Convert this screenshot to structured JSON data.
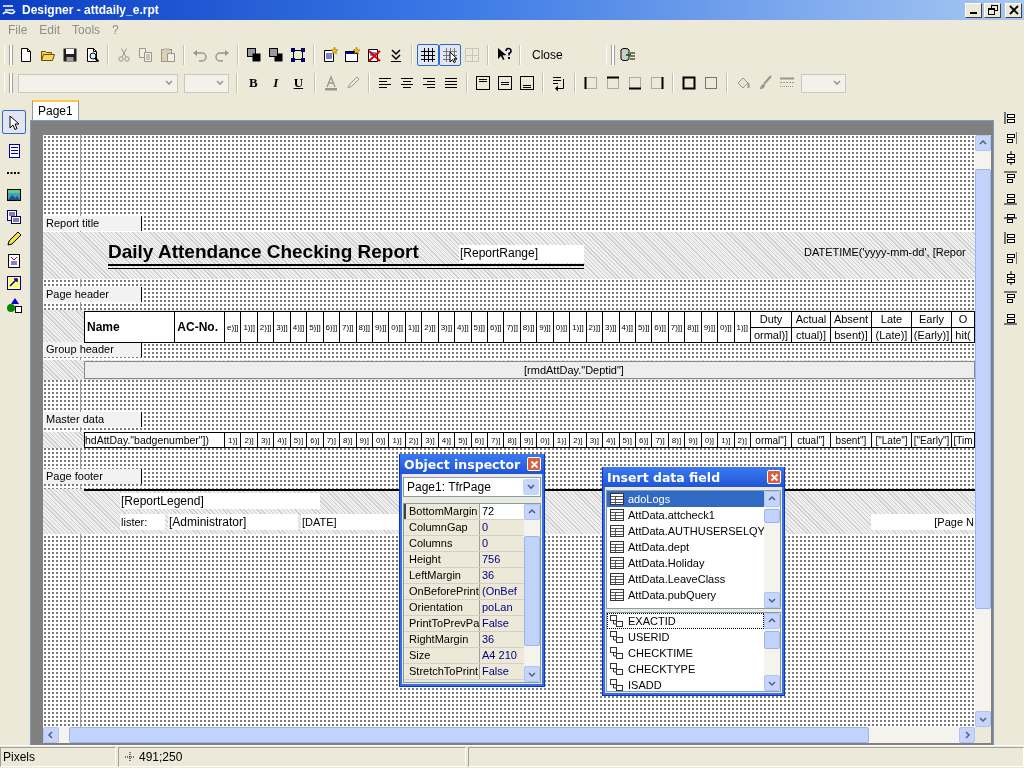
{
  "window": {
    "title": "Designer - attdaily_e.rpt"
  },
  "menu": [
    {
      "label": "File",
      "disabled": true
    },
    {
      "label": "Edit",
      "disabled": true
    },
    {
      "label": "Tools",
      "disabled": true
    },
    {
      "label": "?",
      "disabled": true
    }
  ],
  "toolbars": [
    {
      "items": [
        {
          "kind": "icon",
          "pressed": false,
          "disabled": false
        },
        {
          "kind": "icon",
          "pressed": false,
          "disabled": false
        },
        {
          "kind": "icon",
          "pressed": false,
          "disabled": false
        },
        {
          "kind": "icon",
          "pressed": false,
          "disabled": false
        },
        {
          "kind": "separator"
        },
        {
          "kind": "icon",
          "pressed": false,
          "disabled": true
        },
        {
          "kind": "icon",
          "pressed": false,
          "disabled": true
        },
        {
          "kind": "icon",
          "pressed": false,
          "disabled": true
        },
        {
          "kind": "separator"
        },
        {
          "kind": "icon",
          "pressed": false,
          "disabled": true
        },
        {
          "kind": "icon",
          "pressed": false,
          "disabled": true
        },
        {
          "kind": "separator"
        },
        {
          "kind": "icon",
          "pressed": false,
          "disabled": false
        },
        {
          "kind": "icon",
          "pressed": false,
          "disabled": false
        },
        {
          "kind": "icon",
          "pressed": false,
          "disabled": false
        },
        {
          "kind": "separator"
        },
        {
          "kind": "icon",
          "pressed": false,
          "disabled": false
        },
        {
          "kind": "icon",
          "pressed": false,
          "disabled": false
        },
        {
          "kind": "icon",
          "pressed": false,
          "disabled": false
        },
        {
          "kind": "icon",
          "pressed": false,
          "disabled": false
        },
        {
          "kind": "separator"
        },
        {
          "kind": "icon",
          "pressed": true,
          "disabled": false
        },
        {
          "kind": "icon",
          "pressed": true,
          "disabled": false
        },
        {
          "kind": "icon",
          "pressed": false,
          "disabled": true
        },
        {
          "kind": "separator"
        },
        {
          "kind": "icon",
          "pressed": false,
          "disabled": false
        },
        {
          "kind": "separator"
        },
        {
          "kind": "text",
          "label": "Close",
          "disabled": false
        }
      ]
    },
    {
      "items": [
        {
          "kind": "icon",
          "pressed": false,
          "disabled": false
        }
      ]
    },
    {
      "items": [
        {
          "kind": "combo",
          "disabled": true
        },
        {
          "kind": "combo",
          "disabled": true
        },
        {
          "kind": "separator"
        },
        {
          "kind": "text",
          "label": "B",
          "disabled": false
        },
        {
          "kind": "text",
          "label": "I",
          "disabled": false
        },
        {
          "kind": "text",
          "label": "U",
          "disabled": false
        },
        {
          "kind": "separator"
        },
        {
          "kind": "icon",
          "pressed": false,
          "disabled": true
        },
        {
          "kind": "icon",
          "pressed": false,
          "disabled": true
        },
        {
          "kind": "separator"
        },
        {
          "kind": "icon",
          "pressed": false,
          "disabled": false
        },
        {
          "kind": "icon",
          "pressed": false,
          "disabled": false
        },
        {
          "kind": "icon",
          "pressed": false,
          "disabled": false
        },
        {
          "kind": "icon",
          "pressed": false,
          "disabled": false
        },
        {
          "kind": "separator"
        },
        {
          "kind": "icon",
          "pressed": false,
          "disabled": false
        },
        {
          "kind": "icon",
          "pressed": false,
          "disabled": false
        },
        {
          "kind": "icon",
          "pressed": false,
          "disabled": false
        },
        {
          "kind": "separator"
        },
        {
          "kind": "icon",
          "pressed": false,
          "disabled": false
        },
        {
          "kind": "separator"
        },
        {
          "kind": "icon",
          "pressed": false,
          "disabled": false
        },
        {
          "kind": "icon",
          "pressed": false,
          "disabled": false
        },
        {
          "kind": "icon",
          "pressed": false,
          "disabled": false
        },
        {
          "kind": "icon",
          "pressed": false,
          "disabled": false
        },
        {
          "kind": "separator"
        },
        {
          "kind": "icon",
          "pressed": false,
          "disabled": false
        },
        {
          "kind": "icon",
          "pressed": false,
          "disabled": false
        },
        {
          "kind": "separator"
        },
        {
          "kind": "icon",
          "pressed": false,
          "disabled": true
        },
        {
          "kind": "icon",
          "pressed": false,
          "disabled": true
        },
        {
          "kind": "icon",
          "pressed": false,
          "disabled": true
        },
        {
          "kind": "combo",
          "disabled": true
        }
      ]
    }
  ],
  "tool_palette": [
    {
      "selected": true
    },
    {
      "selected": false
    },
    {
      "selected": false
    },
    {
      "selected": false
    },
    {
      "selected": false
    },
    {
      "selected": false
    },
    {
      "selected": false
    },
    {
      "selected": false
    },
    {
      "selected": false
    }
  ],
  "tabs": [
    {
      "label": "Page1",
      "selected": true
    }
  ],
  "report": {
    "bands": [
      {
        "label": "Report title"
      },
      {
        "label": "Page header"
      },
      {
        "label": "Group header"
      },
      {
        "label": "Master data"
      },
      {
        "label": "Page footer"
      }
    ],
    "report_title": {
      "title": "Daily Attendance Checking Report",
      "range": "[ReportRange]",
      "date_expression": "DATETIME('yyyy-mm-dd', [Repor"
    },
    "page_header": {
      "columns": [
        "Name",
        "AC-No."
      ],
      "day_cells": [
        "e)]]",
        "1)]]",
        "2)]]",
        "3)]]",
        "4)]]",
        "5)]]",
        "6)]]",
        "7)]]",
        "8)]]",
        "9)]]",
        "0)]]",
        "1)]]",
        "2)]]",
        "3)]]",
        "4)]]",
        "5)]]",
        "6)]]",
        "7)]]",
        "8)]]",
        "9)]]",
        "0)]]",
        "1)]]",
        "2)]]",
        "3)]]",
        "4)]]",
        "5)]]",
        "6)]]",
        "7)]]",
        "8)]]",
        "9)]]",
        "0)]]",
        "1)]]"
      ],
      "summary_columns": [
        {
          "heading": "Duty",
          "field": "ormal)]"
        },
        {
          "heading": "Actual",
          "field": "ctual)]"
        },
        {
          "heading": "Absent",
          "field": "bsent)]"
        },
        {
          "heading": "Late",
          "field": "(Late)]"
        },
        {
          "heading": "Early",
          "field": "(Early)]"
        },
        {
          "heading": "O",
          "field": "hit("
        }
      ]
    },
    "group_header": {
      "field": "[rmdAttDay.\"Deptid\"]"
    },
    "master_data": {
      "badge_field": "hdAttDay.\"badgenumber\"])",
      "day_cells": [
        "1)]",
        "2)]",
        "3)]",
        "4)]",
        "5)]",
        "6)]",
        "7)]",
        "8)]",
        "9)]",
        "0)]",
        "1)]",
        "2)]",
        "3)]",
        "4)]",
        "5)]",
        "6)]",
        "7)]",
        "8)]",
        "9)]",
        "0)]",
        "1)]",
        "2)]",
        "3)]",
        "4)]",
        "5)]",
        "6)]",
        "7)]",
        "8)]",
        "9)]",
        "0)]",
        "1)]",
        "2)]"
      ],
      "summary_cells": [
        "ormal\"]",
        "ctual\"]",
        "bsent\"]",
        "[\"Late\"]",
        "[\"Early\"]",
        "[Tim"
      ]
    },
    "page_footer": {
      "legend": "[ReportLegend]",
      "lister_label": "lister:",
      "lister": "[Administrator]",
      "date": "[DATE]",
      "page_number": "[Page N"
    }
  },
  "object_inspector": {
    "title": "Object inspector",
    "object": "Page1: TfrPage",
    "properties": [
      {
        "name": "BottomMargin",
        "value": "72",
        "selected": true
      },
      {
        "name": "ColumnGap",
        "value": "0",
        "selected": false
      },
      {
        "name": "Columns",
        "value": "0",
        "selected": false
      },
      {
        "name": "Height",
        "value": "756",
        "selected": false
      },
      {
        "name": "LeftMargin",
        "value": "36",
        "selected": false
      },
      {
        "name": "OnBeforePrint",
        "value": "(OnBef",
        "selected": false
      },
      {
        "name": "Orientation",
        "value": "poLan",
        "selected": false
      },
      {
        "name": "PrintToPrevPa",
        "value": "False",
        "selected": false
      },
      {
        "name": "RightMargin",
        "value": "36",
        "selected": false
      },
      {
        "name": "Size",
        "value": "A4 210",
        "selected": false
      },
      {
        "name": "StretchToPrint",
        "value": "False",
        "selected": false
      }
    ]
  },
  "insert_data_field": {
    "title": "Insert data field",
    "datasets": [
      {
        "label": "adoLogs",
        "selected": true
      },
      {
        "label": "AttData.attcheck1",
        "selected": false
      },
      {
        "label": "AttData.AUTHUSERSELQY",
        "selected": false
      },
      {
        "label": "AttData.dept",
        "selected": false
      },
      {
        "label": "AttData.Holiday",
        "selected": false
      },
      {
        "label": "AttData.LeaveClass",
        "selected": false
      },
      {
        "label": "AttData.pubQuery",
        "selected": false
      }
    ],
    "fields": [
      {
        "label": "EXACTID",
        "selected": true
      },
      {
        "label": "USERID",
        "selected": false
      },
      {
        "label": "CHECKTIME",
        "selected": false
      },
      {
        "label": "CHECKTYPE",
        "selected": false
      },
      {
        "label": "ISADD",
        "selected": false
      }
    ]
  },
  "status_bar": {
    "units": "Pixels",
    "cursor_position": "491;250"
  }
}
